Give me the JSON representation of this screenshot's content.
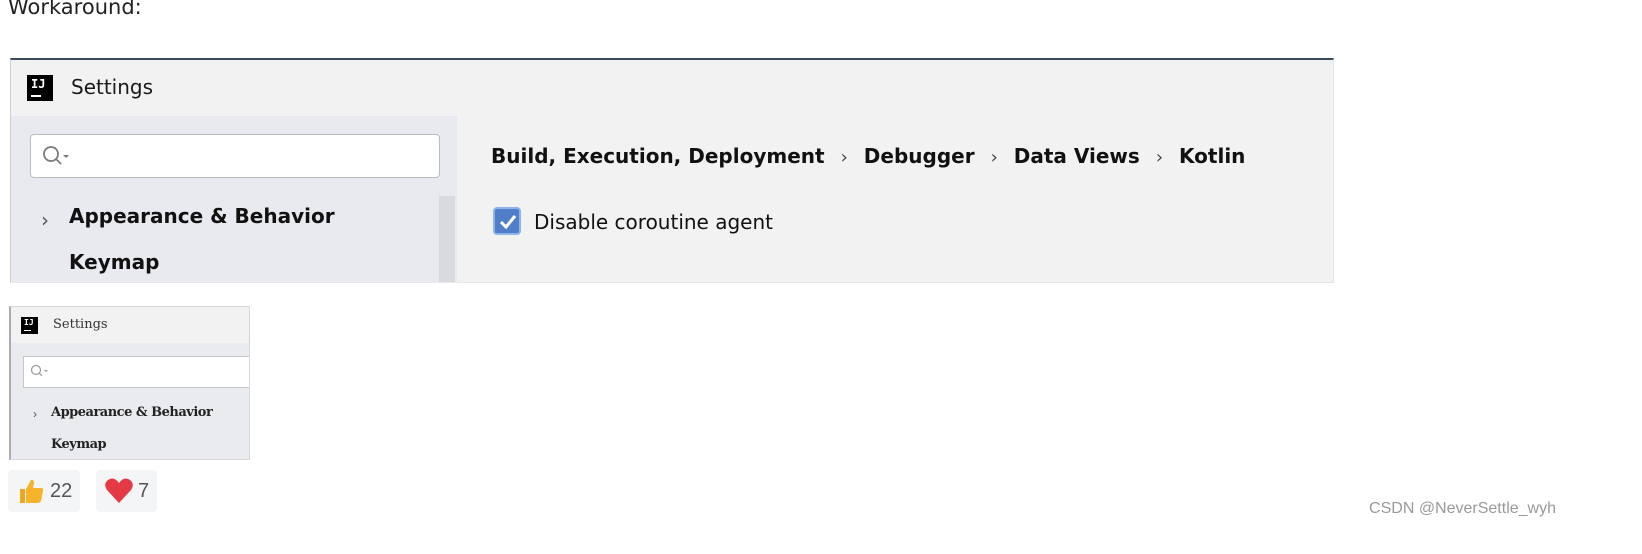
{
  "heading": "Workaround:",
  "settings": {
    "title": "Settings",
    "app_logo_text": "IJ",
    "search": {
      "value": "",
      "placeholder": ""
    },
    "tree": [
      "Appearance & Behavior",
      "Keymap"
    ],
    "breadcrumb": [
      "Build, Execution, Deployment",
      "Debugger",
      "Data Views",
      "Kotlin"
    ],
    "checkbox": {
      "label": "Disable coroutine agent",
      "checked": true
    }
  },
  "thumbnail": {
    "title": "Settings",
    "tree": [
      "Appearance & Behavior",
      "Keymap"
    ]
  },
  "reactions": {
    "like": {
      "icon": "thumbs-up-icon",
      "count": "22"
    },
    "heart": {
      "icon": "heart-icon",
      "count": "7"
    }
  },
  "watermark": "CSDN @NeverSettle_wyh",
  "colors": {
    "checkbox": "#4f7fc9",
    "heart": "#e53945",
    "thumb": "#f5b42b"
  }
}
